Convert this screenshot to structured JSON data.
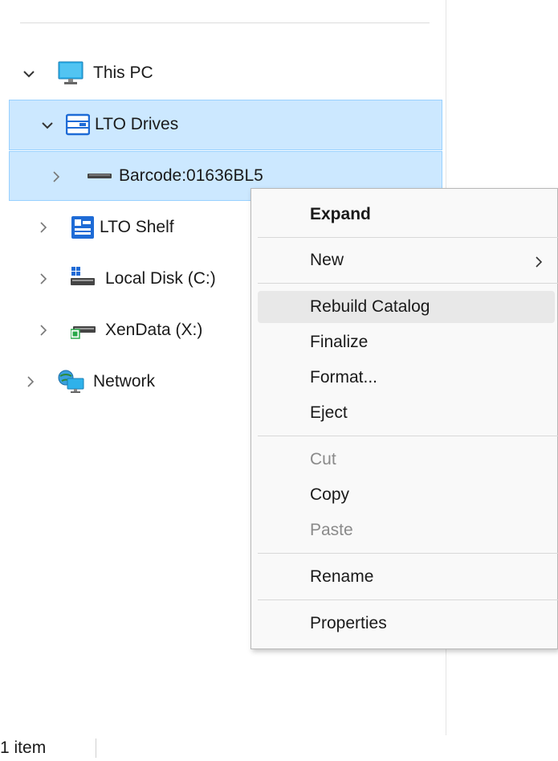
{
  "tree": {
    "this_pc": "This PC",
    "lto_drives": "LTO Drives",
    "barcode": "Barcode:01636BL5",
    "lto_shelf": "LTO Shelf",
    "local_disk": "Local Disk (C:)",
    "xendata": "XenData (X:)",
    "network": "Network"
  },
  "context_menu": {
    "expand": "Expand",
    "new": "New",
    "rebuild_catalog": "Rebuild Catalog",
    "finalize": "Finalize",
    "format": "Format...",
    "eject": "Eject",
    "cut": "Cut",
    "copy": "Copy",
    "paste": "Paste",
    "rename": "Rename",
    "properties": "Properties"
  },
  "status_bar": {
    "item_count": "1 item"
  },
  "colors": {
    "selection_bg": "#cce8ff",
    "selection_border": "#99d1ff",
    "menu_bg": "#f9f9f9",
    "hover_bg": "#e8e8e8"
  },
  "icons": {
    "this_pc": "monitor-icon",
    "lto_drives": "tape-drive-icon",
    "barcode": "tape-cartridge-icon",
    "lto_shelf": "tape-shelf-icon",
    "local_disk": "local-disk-icon",
    "xendata": "network-drive-icon",
    "network": "network-icon"
  }
}
